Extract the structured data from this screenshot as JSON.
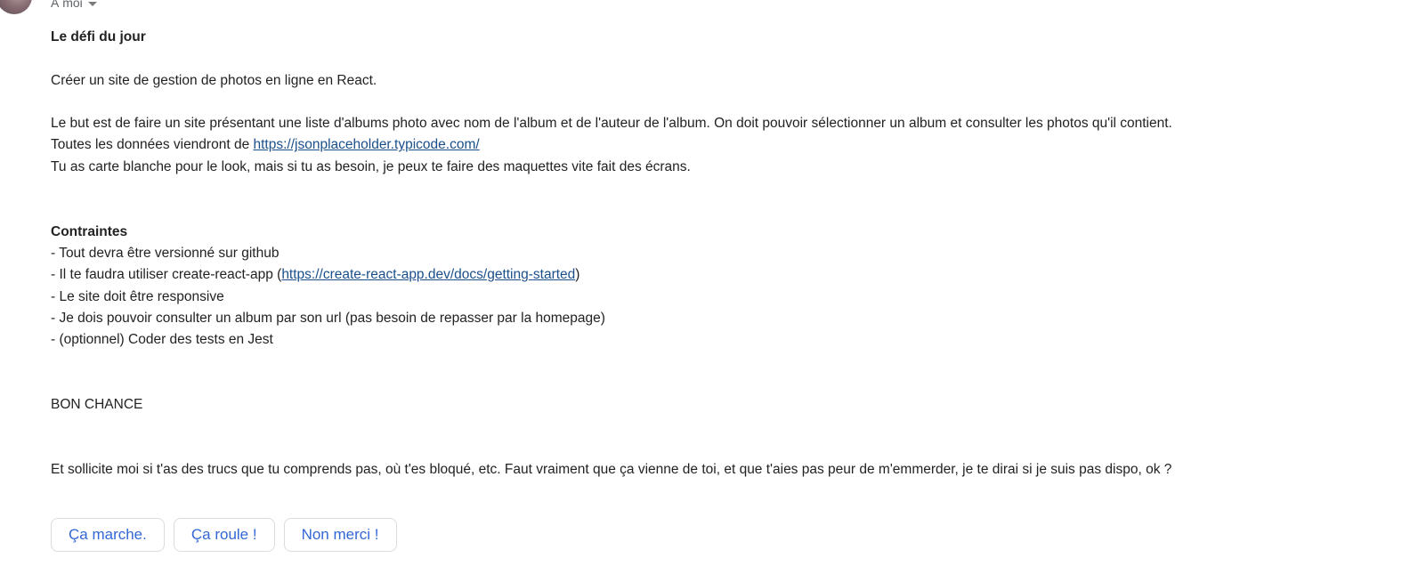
{
  "header": {
    "recipient_label": "À moi"
  },
  "message": {
    "title": "Le défi du jour",
    "intro": "Créer un site de gestion de photos en ligne en React.",
    "para1_line1": "Le but est de faire un site présentant une liste d'albums photo avec nom de l'album et de l'auteur de l'album. On doit pouvoir sélectionner un album et consulter les photos qu'il contient.",
    "para1_line2_prefix": "Toutes les données viendront de ",
    "para1_line2_link": "https://jsonplaceholder.typicode.com/",
    "para1_line3": "Tu as carte blanche pour le look, mais si tu as besoin, je peux te faire des maquettes vite fait des écrans.",
    "constraints_title": "Contraintes",
    "constraint_1": "- Tout devra être versionné sur github",
    "constraint_2_prefix": "- Il te faudra utiliser create-react-app (",
    "constraint_2_link": "https://create-react-app.dev/docs/getting-started",
    "constraint_2_suffix": ")",
    "constraint_3": "- Le site doit être responsive",
    "constraint_4": "- Je dois pouvoir consulter un album par son url (pas besoin de repasser par la homepage)",
    "constraint_5": "- (optionnel) Coder des tests en Jest",
    "good_luck": "BON CHANCE",
    "closing": "Et sollicite moi si t'as des trucs que tu comprends pas, où t'es bloqué, etc. Faut vraiment que ça vienne de toi, et que t'aies pas peur de m'emmerder, je te dirai si je suis pas dispo, ok ?"
  },
  "smart_replies": [
    "Ça marche.",
    "Ça roule !",
    "Non merci !"
  ],
  "colors": {
    "link": "#1a4f8b",
    "chip_text": "#3367d6",
    "chip_border": "#dadce0",
    "body_text": "#222222"
  }
}
